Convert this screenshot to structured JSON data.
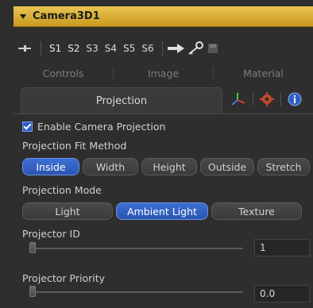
{
  "header": {
    "title": "Camera3D1"
  },
  "toolbar": {
    "slots": [
      "S1",
      "S2",
      "S3",
      "S4",
      "S5",
      "S6"
    ]
  },
  "tabs": {
    "controls": "Controls",
    "image": "Image",
    "material": "Material",
    "projection": "Projection"
  },
  "projection": {
    "enable_label": "Enable Camera Projection",
    "enabled": true,
    "fit_method_label": "Projection Fit Method",
    "fit_methods": [
      "Inside",
      "Width",
      "Height",
      "Outside",
      "Stretch"
    ],
    "fit_selected": "Inside",
    "mode_label": "Projection Mode",
    "modes": [
      "Light",
      "Ambient Light",
      "Texture"
    ],
    "mode_selected": "Ambient Light",
    "projector_id_label": "Projector ID",
    "projector_id_value": "1",
    "projector_priority_label": "Projector Priority",
    "projector_priority_value": "0.0"
  },
  "colors": {
    "accent": "#2f5fc2",
    "title_bar": "#d9ae3a"
  }
}
